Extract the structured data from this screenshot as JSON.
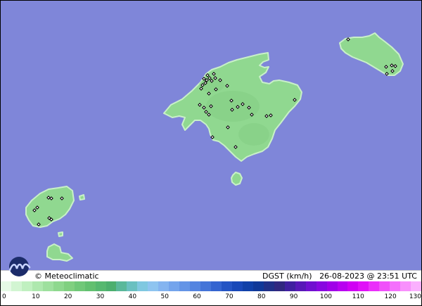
{
  "map": {
    "credit": "© Meteoclimatic",
    "variable": "DGST (km/h)",
    "timestamp": "26-08-2023 @ 23:51 UTC",
    "sea_color": "#7f86d9",
    "land_color": "#90d890",
    "coast_color": "#c8f0c8"
  },
  "scale": {
    "labels": [
      "0",
      "10",
      "20",
      "30",
      "40",
      "50",
      "60",
      "70",
      "80",
      "90",
      "100",
      "110",
      "120",
      "130"
    ],
    "colors": [
      "#e6fae6",
      "#d2f5d2",
      "#c0f0c0",
      "#aee8ae",
      "#9ee09e",
      "#8ed88e",
      "#80d080",
      "#70c878",
      "#62c070",
      "#56b870",
      "#4caf6e",
      "#5ab89a",
      "#6ac0c0",
      "#80c8e0",
      "#8ec4f0",
      "#84b4f0",
      "#74a4ec",
      "#6494e6",
      "#5484e0",
      "#4474d8",
      "#3464d0",
      "#2454c4",
      "#1848b8",
      "#1040a8",
      "#103898",
      "#203088",
      "#302880",
      "#4020a0",
      "#5818b8",
      "#7010d0",
      "#8808e0",
      "#a000e8",
      "#b800f0",
      "#d000f4",
      "#e010f8",
      "#ea30fa",
      "#f050fa",
      "#f470fc",
      "#f890fc",
      "#fab0fe"
    ]
  }
}
